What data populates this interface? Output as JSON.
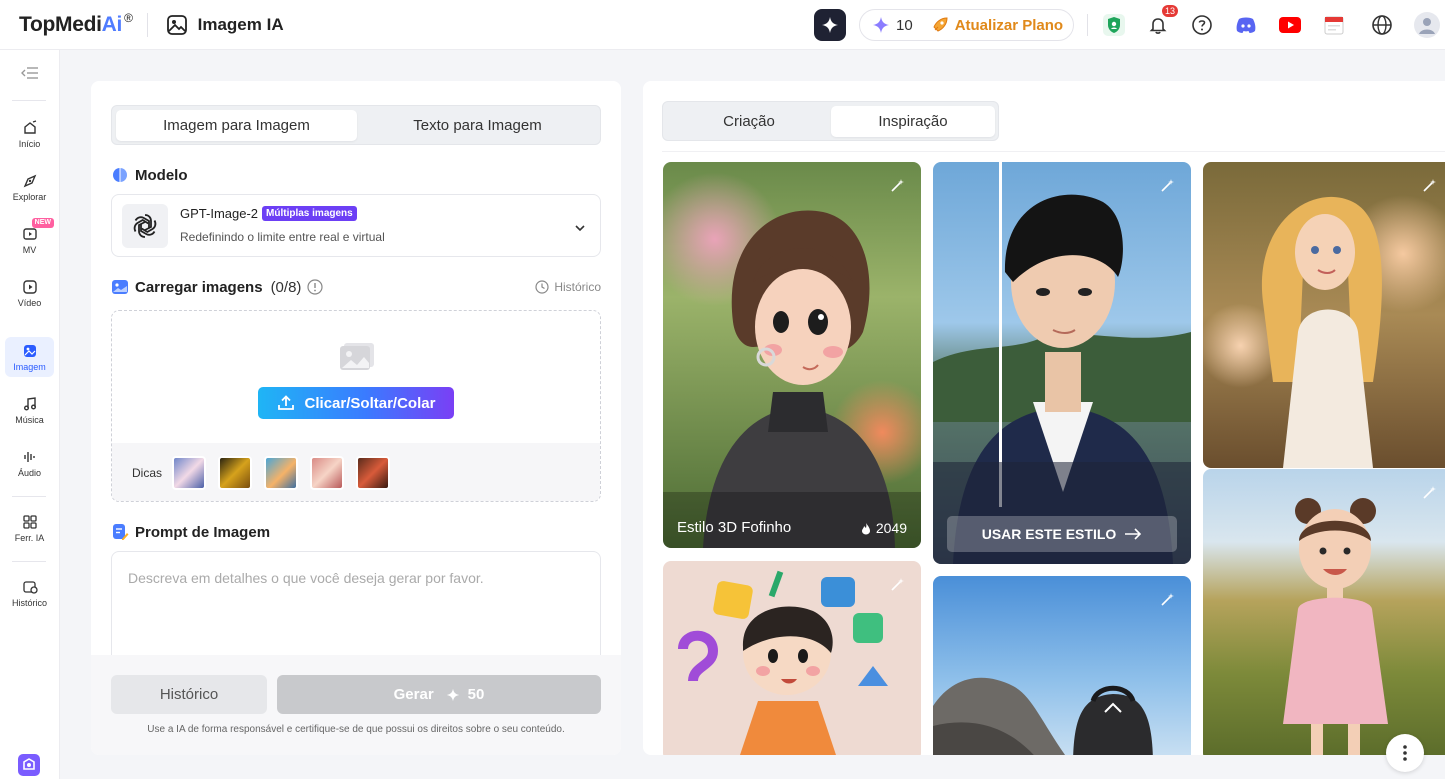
{
  "header": {
    "logo": {
      "part1": "TopMedi",
      "part2": "Ai",
      "reg": "®"
    },
    "page_title": "Imagem IA",
    "credits": "10",
    "upgrade_label": "Atualizar Plano",
    "notifications_count": "13",
    "icons": [
      "sparkle-icon",
      "shield-icon",
      "bell-icon",
      "help-icon",
      "discord-icon",
      "youtube-icon",
      "calendar-icon",
      "globe-icon",
      "avatar"
    ]
  },
  "sidebar": {
    "items": [
      {
        "label": "Início",
        "icon": "home-icon"
      },
      {
        "label": "Explorar",
        "icon": "explore-icon"
      },
      {
        "label": "MV",
        "icon": "mv-icon",
        "tag": "NEW"
      },
      {
        "label": "Vídeo",
        "icon": "video-icon"
      },
      {
        "label": "Imagem",
        "icon": "image-icon"
      },
      {
        "label": "Música",
        "icon": "music-icon"
      },
      {
        "label": "Áudio",
        "icon": "audio-icon"
      },
      {
        "label": "Ferr. IA",
        "icon": "tools-icon"
      },
      {
        "label": "Histórico",
        "icon": "history-icon"
      }
    ]
  },
  "left_panel": {
    "tabs": [
      "Imagem para Imagem",
      "Texto para Imagem"
    ],
    "active_tab": "Imagem para Imagem",
    "model": {
      "section_title": "Modelo",
      "name": "GPT-Image-2",
      "tag": "Múltiplas imagens",
      "description": "Redefinindo o limite entre real e virtual"
    },
    "upload": {
      "section_title": "Carregar imagens",
      "count": "(0/8)",
      "history_label": "Histórico",
      "button_label": "Clicar/Soltar/Colar",
      "tips_label": "Dicas"
    },
    "prompt": {
      "section_title": "Prompt de Imagem",
      "placeholder": "Descreva em detalhes o que você deseja gerar por favor."
    },
    "footer": {
      "history_button": "Histórico",
      "generate_label": "Gerar",
      "generate_cost": "50",
      "disclaimer": "Use a IA de forma responsável e certifique-se de que possui os direitos sobre o seu conteúdo."
    }
  },
  "right_panel": {
    "tabs": [
      "Criação",
      "Inspiração"
    ],
    "active_tab": "Inspiração",
    "cards": [
      {
        "title": "Estilo 3D Fofinho",
        "likes": "2049"
      },
      {
        "button": "USAR ESTE ESTILO"
      }
    ]
  },
  "colors": {
    "accent": "#2b5cff",
    "upgrade": "#e0891a",
    "multi_tag": "#6c3ff5"
  }
}
